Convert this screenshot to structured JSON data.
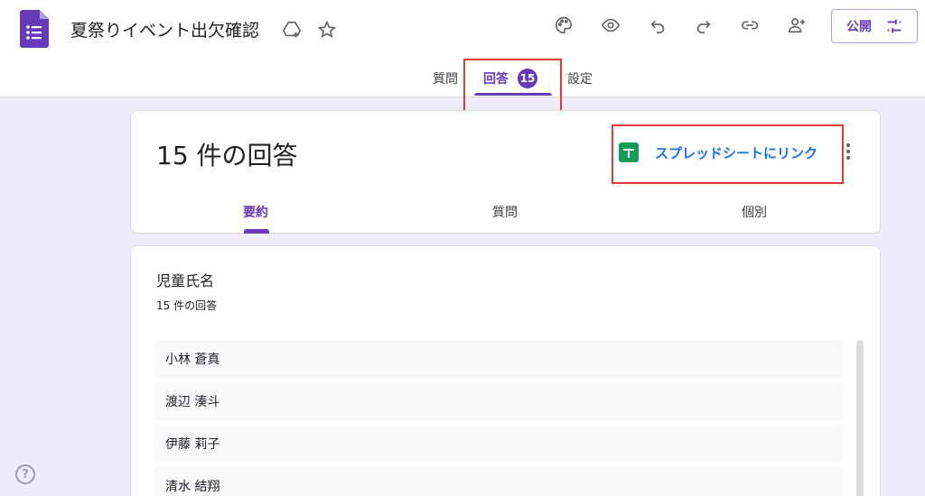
{
  "header": {
    "title": "夏祭りイベント出欠確認",
    "publish_label": "公開"
  },
  "tabs": [
    {
      "label": "質問"
    },
    {
      "label": "回答",
      "badge": "15"
    },
    {
      "label": "設定"
    }
  ],
  "responses": {
    "title": "15 件の回答",
    "sheet_link": "スプレッドシートにリンク",
    "subtabs": [
      {
        "label": "要約"
      },
      {
        "label": "質問"
      },
      {
        "label": "個別"
      }
    ]
  },
  "question": {
    "title": "児童氏名",
    "count": "15 件の回答",
    "answers": [
      "小林 蒼真",
      "渡辺 湊斗",
      "伊藤 莉子",
      "清水 結翔"
    ]
  },
  "help": "?",
  "colors": {
    "accent": "#673ab7",
    "link": "#1a73e8",
    "highlight_box": "#e53935",
    "background": "#f0ebf8"
  }
}
